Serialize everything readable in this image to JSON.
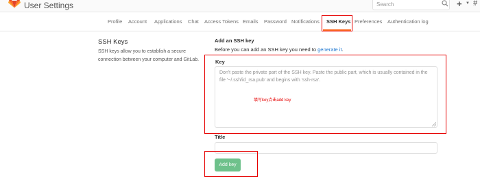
{
  "header": {
    "title": "User Settings",
    "search_placeholder": "Search",
    "icons": [
      "gitlab-logo",
      "search-icon",
      "plus-icon",
      "caret-down-icon",
      "more-icon"
    ]
  },
  "tabs": [
    {
      "label": "Profile",
      "active": false
    },
    {
      "label": "Account",
      "active": false
    },
    {
      "label": "Applications",
      "active": false
    },
    {
      "label": "Chat",
      "active": false
    },
    {
      "label": "Access Tokens",
      "active": false
    },
    {
      "label": "Emails",
      "active": false
    },
    {
      "label": "Password",
      "active": false
    },
    {
      "label": "Notifications",
      "active": false
    },
    {
      "label": "SSH Keys",
      "active": true
    },
    {
      "label": "Preferences",
      "active": false
    },
    {
      "label": "Authentication log",
      "active": false
    }
  ],
  "section": {
    "title": "SSH Keys",
    "description": "SSH keys allow you to establish a secure connection between your computer and GitLab."
  },
  "form": {
    "heading": "Add an SSH key",
    "intro_prefix": "Before you can add an SSH key you need to ",
    "intro_link": "generate it",
    "intro_suffix": ".",
    "key_label": "Key",
    "key_placeholder": "Don't paste the private part of the SSH key. Paste the public part, which is usually contained in the file '~/.ssh/id_rsa.pub' and begins with 'ssh-rsa'.",
    "title_label": "Title",
    "title_value": "",
    "submit_label": "Add key"
  },
  "annotation": {
    "text": "填写key点击add key",
    "color": "#e60000"
  },
  "colors": {
    "accent": "#fc6d26",
    "link": "#1f78d1",
    "button": "#6ec18b"
  }
}
